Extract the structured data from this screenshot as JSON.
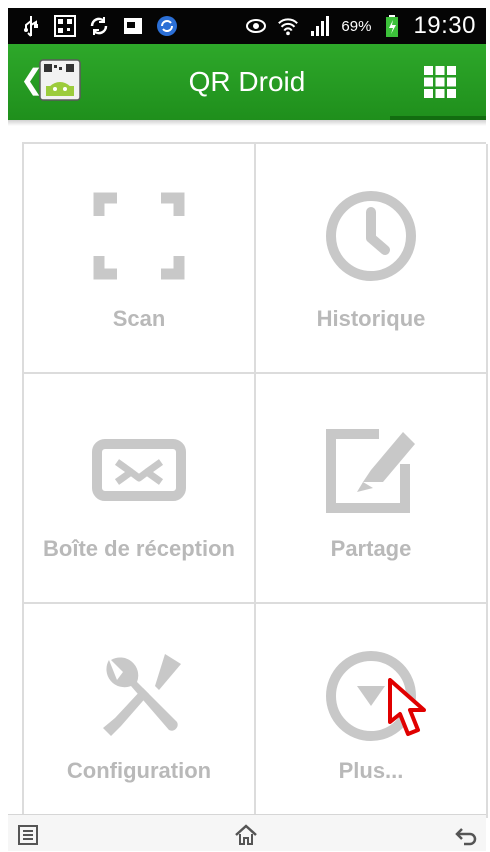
{
  "status_bar": {
    "battery_percent": "69%",
    "time": "19:30"
  },
  "action_bar": {
    "back_glyph": "❮",
    "title": "QR Droid"
  },
  "tiles": [
    {
      "label": "Scan",
      "icon": "scan-frame-icon"
    },
    {
      "label": "Historique",
      "icon": "clock-icon"
    },
    {
      "label": "Boîte de réception",
      "icon": "inbox-envelope-icon"
    },
    {
      "label": "Partage",
      "icon": "edit-pencil-icon"
    },
    {
      "label": "Configuration",
      "icon": "tools-icon"
    },
    {
      "label": "Plus...",
      "icon": "dropdown-circle-icon"
    }
  ],
  "colors": {
    "accent_green": "#2ea82a",
    "tile_icon_gray": "#c8c8c8",
    "tile_text_gray": "#b9b9b9"
  }
}
